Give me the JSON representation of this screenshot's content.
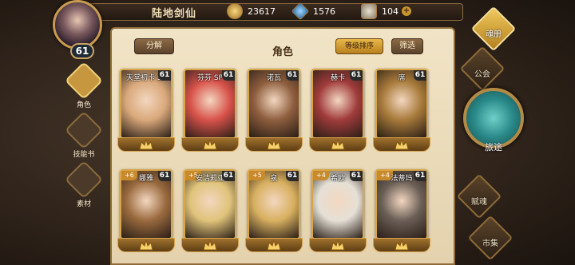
{
  "player": {
    "name": "陆地剑仙",
    "level": "61"
  },
  "resources": {
    "gold": "23617",
    "gems": "1576",
    "stamina": "104",
    "plus_icon": "plus-icon"
  },
  "left_menu": [
    {
      "label": "角色",
      "icon": "helmet-icon",
      "active": true
    },
    {
      "label": "技能书",
      "icon": "scroll-icon",
      "active": false
    },
    {
      "label": "素材",
      "icon": "paw-icon",
      "active": false
    }
  ],
  "panel": {
    "title": "角色",
    "split_label": "分解",
    "sort_label": "等级排序",
    "filter_label": "筛选"
  },
  "cards": [
    {
      "name": "天堂初卡 SP",
      "level": "61",
      "star": "",
      "color": "#d9a87a"
    },
    {
      "name": "芬芬 SP",
      "level": "61",
      "star": "",
      "color": "#d8524a"
    },
    {
      "name": "诺瓦",
      "level": "61",
      "star": "",
      "color": "#8e5e3e"
    },
    {
      "name": "赫卡",
      "level": "61",
      "star": "",
      "color": "#a03b3b"
    },
    {
      "name": "席",
      "level": "61",
      "star": "",
      "color": "#a87a3a"
    },
    {
      "name": "娜雅",
      "level": "61",
      "star": "+6",
      "color": "#9a6a3e"
    },
    {
      "name": "安洁莉亚",
      "level": "61",
      "star": "+5",
      "color": "#e0c37a"
    },
    {
      "name": "泉",
      "level": "61",
      "star": "+5",
      "color": "#d8b060"
    },
    {
      "name": "希欧",
      "level": "61",
      "star": "+4",
      "color": "#e5e0d6"
    },
    {
      "name": "法蒂玛",
      "level": "61",
      "star": "+4",
      "color": "#6a5e56"
    }
  ],
  "right_menu": [
    {
      "label": "魂册",
      "icon": "wings-crest-icon",
      "active": true
    },
    {
      "label": "公会",
      "icon": "guild-banner-icon",
      "active": false
    },
    {
      "label": "旅途",
      "icon": "journey-emblem-icon",
      "active": false
    },
    {
      "label": "赋魂",
      "icon": "swirl-icon",
      "active": false
    },
    {
      "label": "市集",
      "icon": "market-cart-icon",
      "active": false
    }
  ]
}
